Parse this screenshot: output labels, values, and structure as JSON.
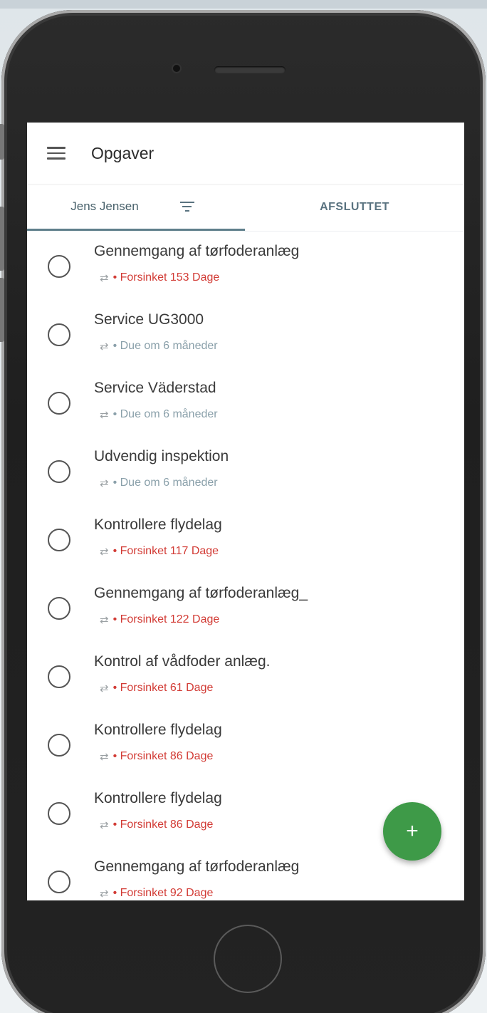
{
  "header": {
    "title": "Opgaver"
  },
  "tabs": [
    {
      "label": "Jens Jensen",
      "active": true
    },
    {
      "label": "AFSLUTTET",
      "active": false
    }
  ],
  "tasks": [
    {
      "title": "Gennemgang af tørfoderanlæg",
      "status": "• Forsinket 153 Dage",
      "state": "late"
    },
    {
      "title": "Service UG3000",
      "status": "• Due om 6 måneder",
      "state": "due"
    },
    {
      "title": "Service Väderstad",
      "status": "• Due om 6 måneder",
      "state": "due"
    },
    {
      "title": "Udvendig inspektion",
      "status": "• Due om 6 måneder",
      "state": "due"
    },
    {
      "title": "Kontrollere flydelag",
      "status": "• Forsinket 117 Dage",
      "state": "late"
    },
    {
      "title": "Gennemgang af tørfoderanlæg_",
      "status": "• Forsinket 122 Dage",
      "state": "late"
    },
    {
      "title": "Kontrol af vådfoder anlæg.",
      "status": "• Forsinket 61 Dage",
      "state": "late"
    },
    {
      "title": "Kontrollere flydelag",
      "status": "• Forsinket 86 Dage",
      "state": "late"
    },
    {
      "title": "Kontrollere flydelag",
      "status": "• Forsinket 86 Dage",
      "state": "late"
    },
    {
      "title": "Gennemgang af tørfoderanlæg",
      "status": "• Forsinket 92 Dage",
      "state": "late"
    }
  ],
  "fab": {
    "label": "+"
  },
  "icons": {
    "menu": "menu-icon",
    "filter": "filter-icon",
    "repeat": "repeat-icon",
    "repeat_glyph": "⇄",
    "checkbox": "radio-circle"
  },
  "colors": {
    "late": "#d23b35",
    "due": "#8aa0aa",
    "fab": "#3e9a48",
    "tab_indicator": "#5f7f8b"
  }
}
